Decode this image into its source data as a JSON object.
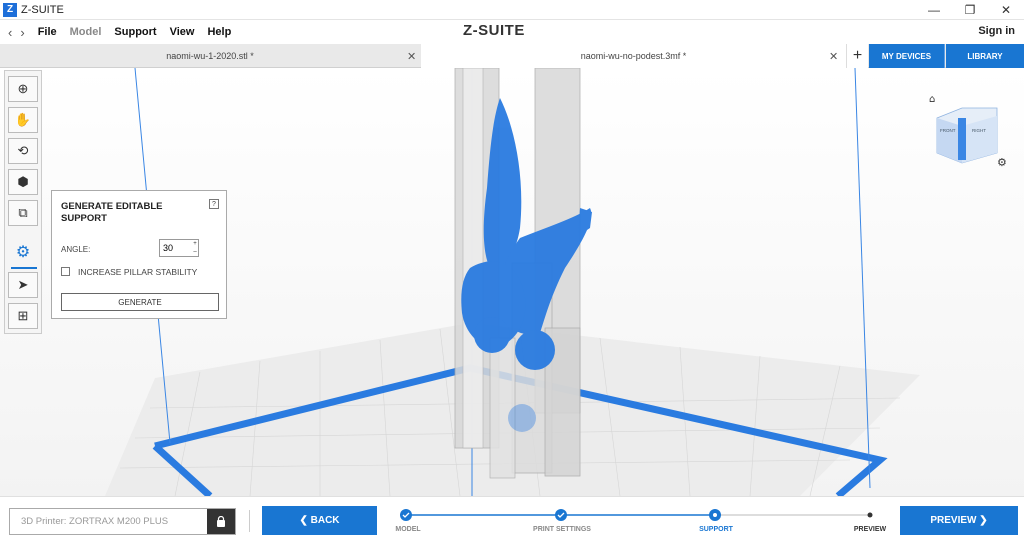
{
  "window": {
    "logo": "Z",
    "title": "Z-SUITE",
    "minimize_icon": "—",
    "restore_icon": "❐",
    "close_icon": "✕"
  },
  "menu": {
    "back_icon": "‹",
    "forward_icon": "›",
    "items": [
      "File",
      "Model",
      "Support",
      "View",
      "Help"
    ],
    "brand": "Z-SUITE",
    "sign_in": "Sign in"
  },
  "tabs": [
    {
      "label": "naomi-wu-1-2020.stl *",
      "close": "✕"
    },
    {
      "label": "naomi-wu-no-podest.3mf *",
      "close": "✕"
    }
  ],
  "tab_add": "+",
  "top_buttons": {
    "my_devices": "MY DEVICES",
    "library": "LIBRARY"
  },
  "toolbar": {
    "zoom_icon": "⊕",
    "pan_icon": "✋",
    "rotate_icon": "⟲",
    "view_icon": "⬢",
    "move_icon": "⧉",
    "support_icon": "⚙",
    "select_icon": "➤",
    "add_icon": "⊞"
  },
  "panel": {
    "title": "GENERATE EDITABLE SUPPORT",
    "help": "?",
    "angle_label": "ANGLE:",
    "angle_value": "30",
    "spin_up": "+",
    "spin_down": "–",
    "checkbox_label": "INCREASE PILLAR STABILITY",
    "checkbox_checked": false,
    "generate_label": "GENERATE"
  },
  "view_cube": {
    "front": "FRONT",
    "right": "RIGHT",
    "home_icon": "⌂",
    "settings_icon": "⚙"
  },
  "footer": {
    "printer": "3D Printer: ZORTRAX M200 PLUS",
    "back_label": "❮  BACK",
    "preview_label": "PREVIEW  ❯",
    "steps": [
      {
        "label": "MODEL",
        "state": "done"
      },
      {
        "label": "PRINT SETTINGS",
        "state": "done"
      },
      {
        "label": "SUPPORT",
        "state": "current"
      },
      {
        "label": "PREVIEW",
        "state": "pending"
      }
    ]
  },
  "colors": {
    "accent": "#1976d2",
    "model": "#2a7be0",
    "support": "#c8c8c8"
  }
}
